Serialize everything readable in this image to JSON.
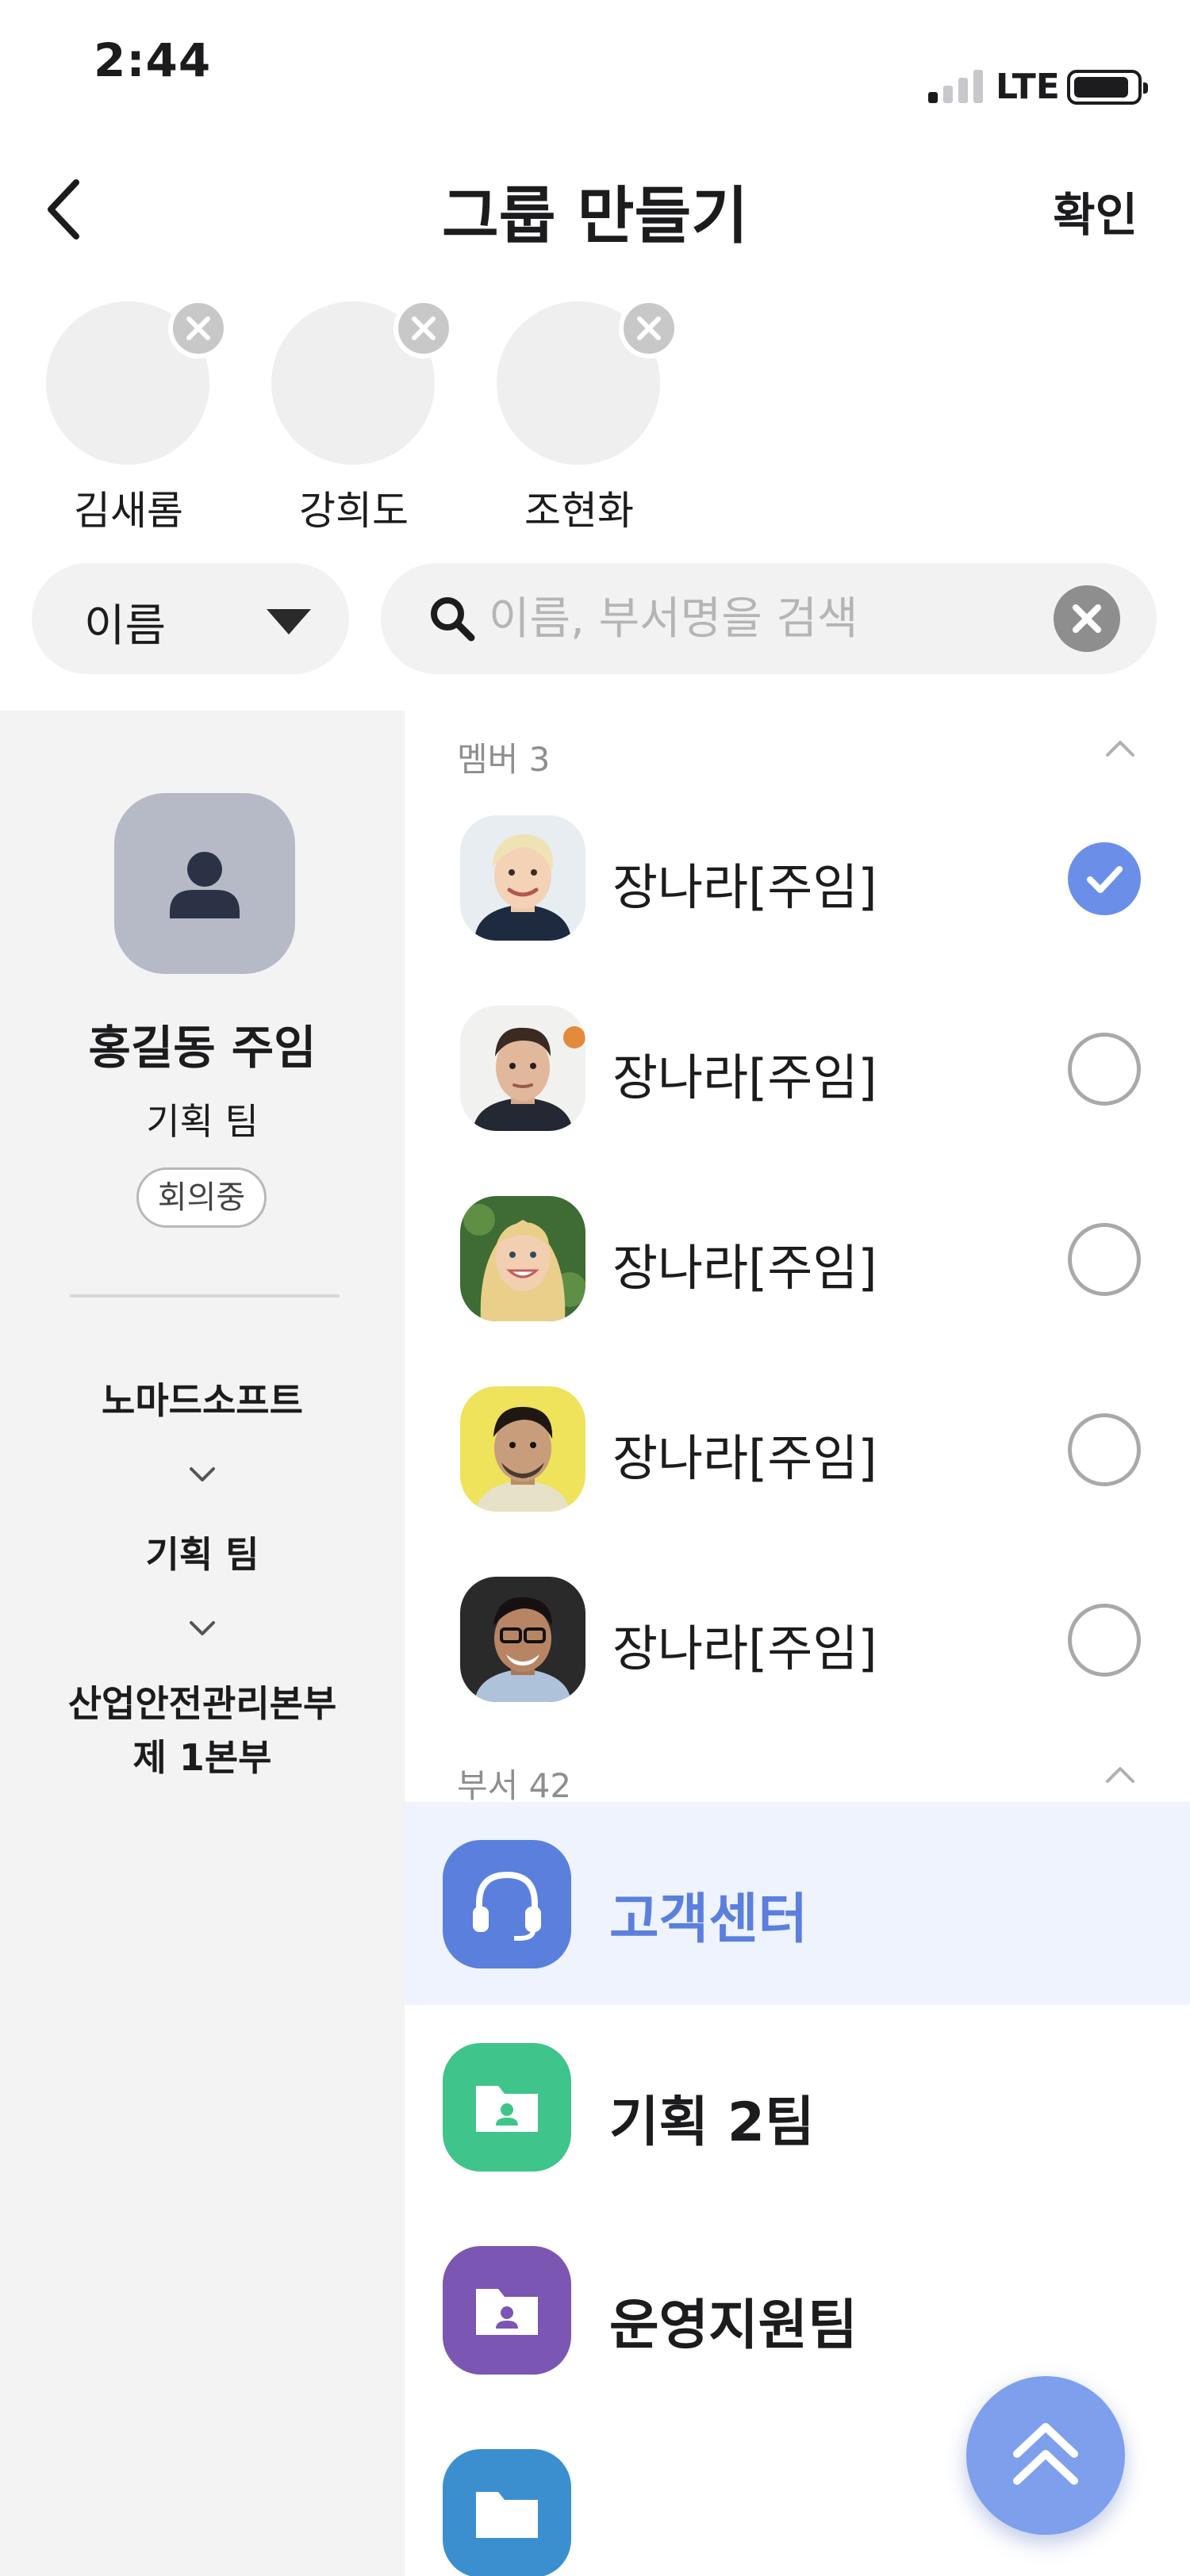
{
  "status_bar": {
    "time": "2:44",
    "network": "LTE"
  },
  "nav": {
    "title": "그룹 만들기",
    "confirm_label": "확인"
  },
  "selected_members": [
    {
      "name": "김새롬"
    },
    {
      "name": "강희도"
    },
    {
      "name": "조현화"
    }
  ],
  "filter": {
    "sort_value": "이름",
    "search_placeholder": "이름, 부서명을 검색",
    "search_value": ""
  },
  "profile": {
    "name": "홍길동 주임",
    "department": "기획 팀",
    "status": "회의중",
    "org_path": [
      "노마드소프트",
      "기획 팀",
      "산업안전관리본부\n제 1본부"
    ]
  },
  "members_section": {
    "title": "멤버 3",
    "items": [
      {
        "name": "장나라[주임]",
        "checked": true,
        "photo": "avatar-woman-blonde-short"
      },
      {
        "name": "장나라[주임]",
        "checked": false,
        "photo": "avatar-man-dark-hair"
      },
      {
        "name": "장나라[주임]",
        "checked": false,
        "photo": "avatar-woman-blonde-long"
      },
      {
        "name": "장나라[주임]",
        "checked": false,
        "photo": "avatar-man-yellow-bg"
      },
      {
        "name": "장나라[주임]",
        "checked": false,
        "photo": "avatar-man-glasses"
      }
    ]
  },
  "departments_section": {
    "title": "부서 42",
    "items": [
      {
        "name": "고객센터",
        "icon": "headset-icon",
        "color": "#5b7fdc",
        "highlighted": true
      },
      {
        "name": "기획 2팀",
        "icon": "folder-user-icon",
        "color": "#3fc48c",
        "highlighted": false
      },
      {
        "name": "운영지원팀",
        "icon": "folder-user-icon",
        "color": "#7c56b3",
        "highlighted": false
      }
    ]
  },
  "colors": {
    "accent": "#6b8fe8",
    "dept_highlight_bg": "#eef3fd",
    "panel_bg": "#f3f3f3"
  }
}
